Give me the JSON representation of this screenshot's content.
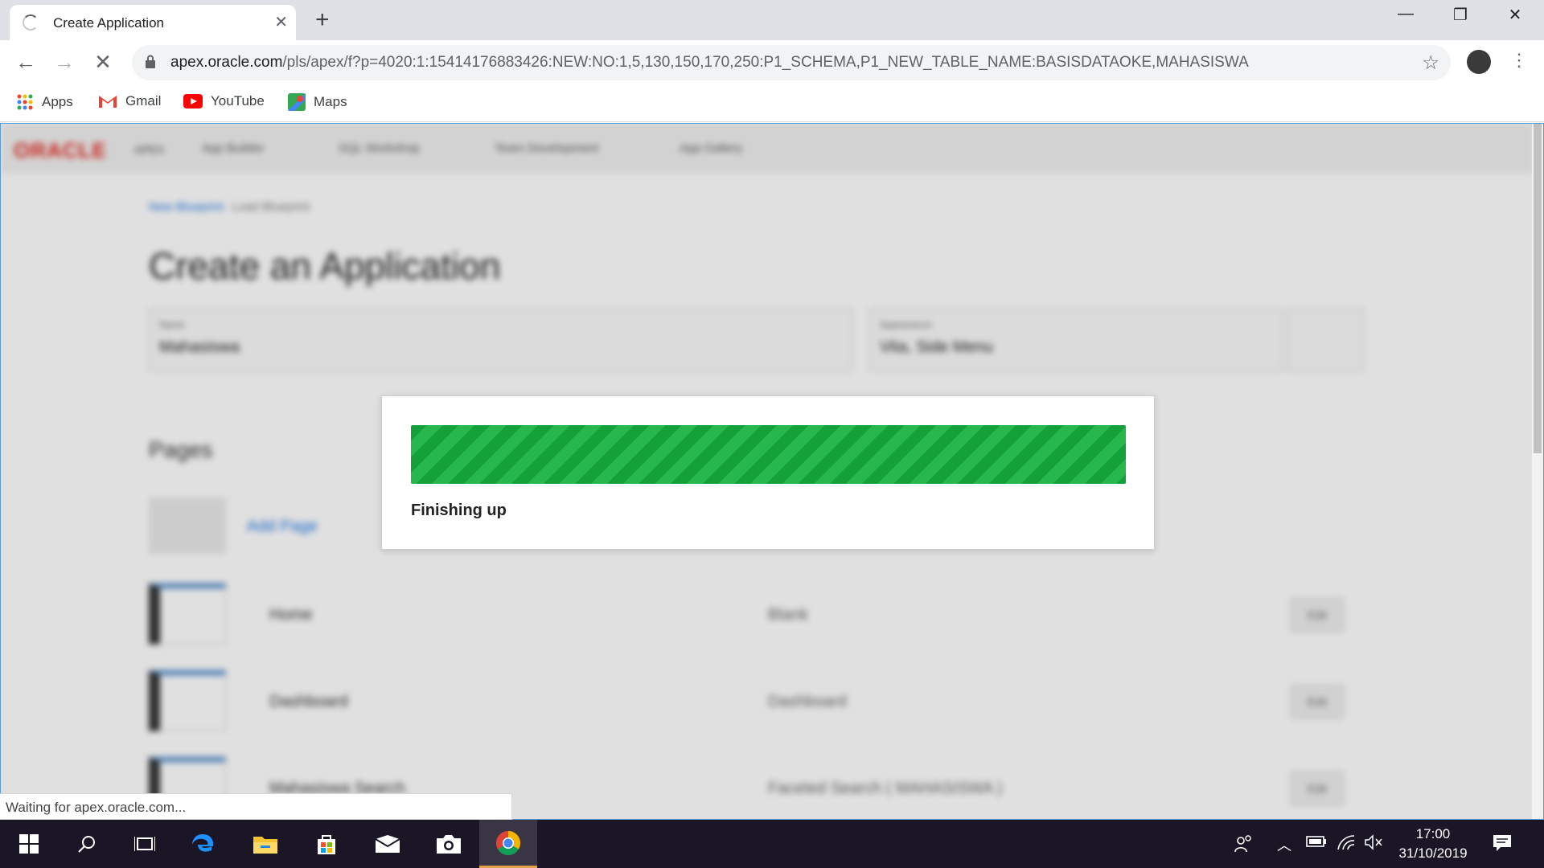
{
  "browser": {
    "tab_title": "Create Application",
    "url_host": "apex.oracle.com",
    "url_path": "/pls/apex/f?p=4020:1:15414176883426:NEW:NO:1,5,130,150,170,250:P1_SCHEMA,P1_NEW_TABLE_NAME:BASISDATAOKE,MAHASISWA",
    "bookmarks": [
      {
        "label": "Apps",
        "icon": "apps-grid-icon"
      },
      {
        "label": "Gmail",
        "icon": "gmail-icon"
      },
      {
        "label": "YouTube",
        "icon": "youtube-icon"
      },
      {
        "label": "Maps",
        "icon": "maps-icon"
      }
    ],
    "status_text": "Waiting for apex.oracle.com..."
  },
  "apex": {
    "logo": "ORACLE",
    "product": "APEX",
    "menu": [
      "App Builder",
      "SQL Workshop",
      "Team Development",
      "App Gallery"
    ],
    "breadcrumb": [
      "New Blueprint",
      "Load Blueprint"
    ],
    "page_title": "Create an Application",
    "name_field": {
      "label": "Name",
      "value": "Mahasiswa"
    },
    "appearance_field": {
      "label": "Appearance",
      "value": "Vita, Side Menu"
    },
    "pages_heading": "Pages",
    "add_page": "Add Page",
    "pages": [
      {
        "name": "Home",
        "type": "Blank",
        "edit": "Edit"
      },
      {
        "name": "Dashboard",
        "type": "Dashboard",
        "edit": "Edit"
      },
      {
        "name": "Mahasiswa Search",
        "type": "Faceted Search ( MAHASISWA )",
        "edit": "Edit"
      }
    ]
  },
  "dialog": {
    "progress": 1.0,
    "message": "Finishing up",
    "bar_color": "#14a13a"
  },
  "taskbar": {
    "time": "17:00",
    "date": "31/10/2019"
  }
}
